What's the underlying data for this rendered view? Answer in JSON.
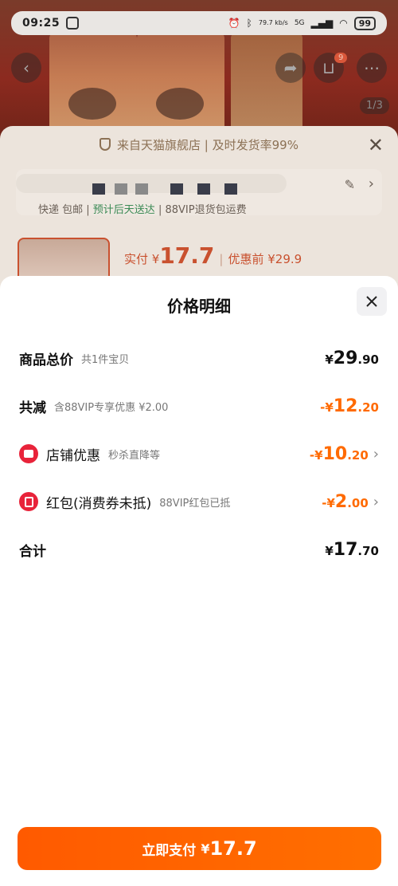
{
  "status_bar": {
    "time": "09:25",
    "net_speed": "79.7 kb/s",
    "network": "5G",
    "battery": "99"
  },
  "background": {
    "image_counter": "1/3",
    "cart_badge": "9",
    "banner_text": "来自天猫旗舰店 | 及时发货率99%",
    "delivery_prefix": "快递 包邮",
    "delivery_eta": "预计后天送达",
    "delivery_suffix": "88VIP退货包运费",
    "paid_label": "实付 ¥",
    "paid_value": "17.7",
    "before_discount": "优惠前 ¥29.9"
  },
  "modal": {
    "title": "价格明细",
    "rows": {
      "total": {
        "label": "商品总价",
        "sub": "共1件宝贝",
        "sym": "¥",
        "int": "29",
        "dec": ".90"
      },
      "reduced": {
        "label": "共减",
        "sub": "含88VIP专享优惠 ¥2.00",
        "sym": "-¥",
        "int": "12",
        "dec": ".20"
      },
      "shop_discount": {
        "label": "店铺优惠",
        "sub": "秒杀直降等",
        "sym": "-¥",
        "int": "10",
        "dec": ".20"
      },
      "red_packet": {
        "label": "红包(消费券未抵)",
        "sub": "88VIP红包已抵",
        "sym": "-¥",
        "int": "2",
        "dec": ".00"
      },
      "sum": {
        "label": "合计",
        "sym": "¥",
        "int": "17",
        "dec": ".70"
      }
    }
  },
  "pay_button": {
    "label": "立即支付",
    "sym": "¥",
    "amount": "17.7"
  },
  "colors": {
    "accent_orange": "#ff6a00",
    "badge_red": "#e8233a"
  }
}
